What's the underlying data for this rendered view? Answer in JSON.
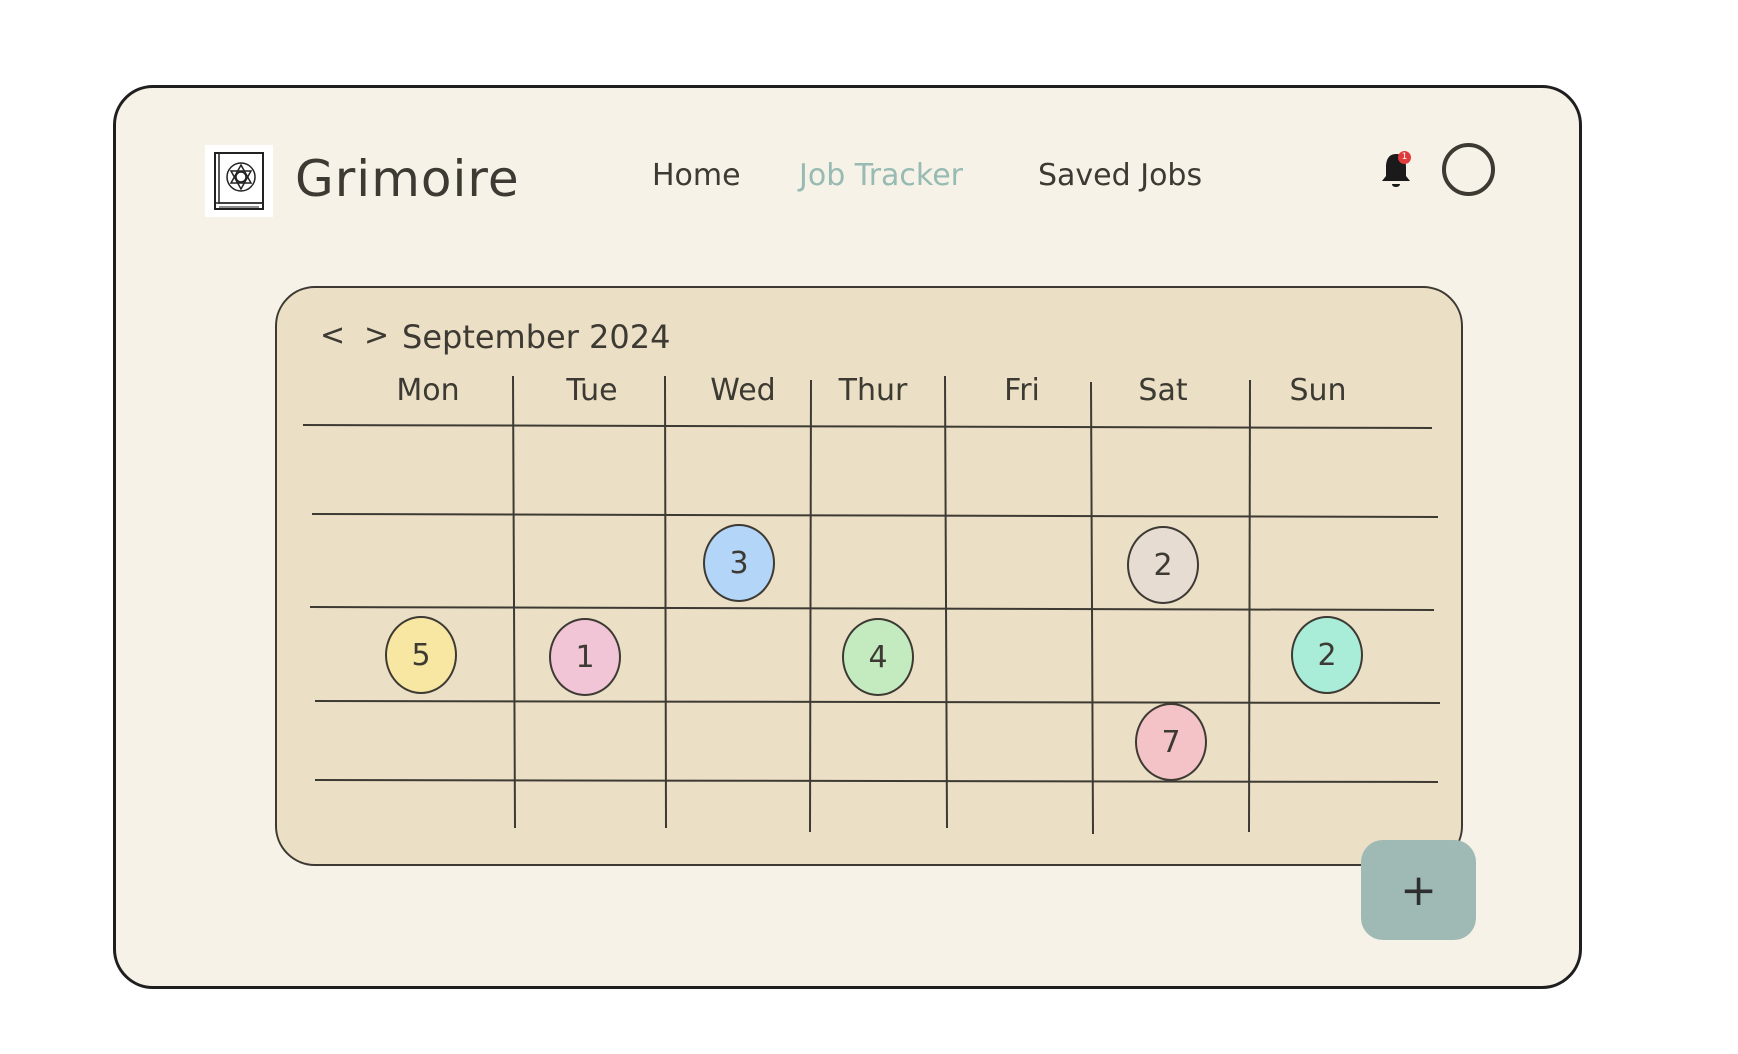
{
  "app": {
    "name": "Grimoire",
    "logo_icon": "spellbook-icon"
  },
  "nav": {
    "items": [
      {
        "label": "Home",
        "active": false
      },
      {
        "label": "Job Tracker",
        "active": true
      },
      {
        "label": "Saved Jobs",
        "active": false
      }
    ],
    "active_color": "#97bbb2"
  },
  "header": {
    "notification_icon": "bell-icon",
    "notification_count": "1",
    "avatar_icon": "user-avatar-icon"
  },
  "calendar": {
    "prev_label": "<",
    "next_label": ">",
    "month_title": "September 2024",
    "days": [
      "Mon",
      "Tue",
      "Wed",
      "Thur",
      "Fri",
      "Sat",
      "Sun"
    ],
    "rows": 4,
    "events": [
      {
        "row": 1,
        "day": "Wed",
        "count": "3",
        "color": "#b3d5f7"
      },
      {
        "row": 1,
        "day": "Sat",
        "count": "2",
        "color": "#e6dcd1"
      },
      {
        "row": 2,
        "day": "Mon",
        "count": "5",
        "color": "#f8e7a2"
      },
      {
        "row": 2,
        "day": "Tue",
        "count": "1",
        "color": "#f1c4d6"
      },
      {
        "row": 2,
        "day": "Thur",
        "count": "4",
        "color": "#c4ebbf"
      },
      {
        "row": 2,
        "day": "Sun",
        "count": "2",
        "color": "#a9ecd8"
      },
      {
        "row": 3,
        "day": "Sat",
        "count": "7",
        "color": "#f4c3c8"
      }
    ],
    "panel_color": "#ebe0c6"
  },
  "fab": {
    "label": "+",
    "color": "#9fbab5"
  }
}
